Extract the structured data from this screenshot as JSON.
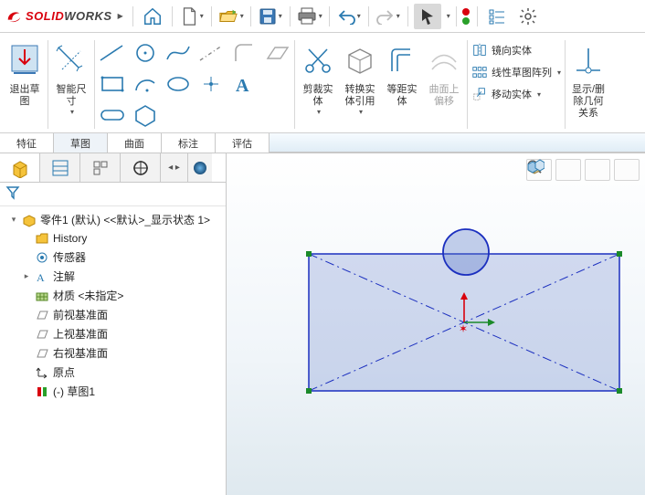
{
  "app": {
    "name_solid": "SOLID",
    "name_works": "WORKS"
  },
  "quick_access": {
    "home": "home-icon",
    "new": "new-icon",
    "open": "open-icon",
    "save": "save-icon",
    "print": "print-icon",
    "undo": "undo-icon",
    "redo": "redo-icon",
    "select": "select-icon"
  },
  "ribbon": {
    "exit_sketch": "退出草\n图",
    "smart_dim": "智能尺\n寸",
    "trim": "剪裁实\n体",
    "convert": "转换实\n体引用",
    "offset": "等距实\n体",
    "surface_offset": "曲面上\n偏移",
    "mirror": "镜向实体",
    "linear_pattern": "线性草图阵列",
    "move": "移动实体",
    "display_delete": "显示/删\n除几何\n关系"
  },
  "tabs": {
    "features": "特征",
    "sketch": "草图",
    "surfaces": "曲面",
    "annotate": "标注",
    "evaluate": "评估"
  },
  "tree": {
    "root": "零件1 (默认) <<默认>_显示状态 1>",
    "history": "History",
    "sensors": "传感器",
    "annotations": "注解",
    "material": "材质 <未指定>",
    "front_plane": "前视基准面",
    "top_plane": "上视基准面",
    "right_plane": "右视基准面",
    "origin": "原点",
    "sketch1": "(-) 草图1"
  }
}
